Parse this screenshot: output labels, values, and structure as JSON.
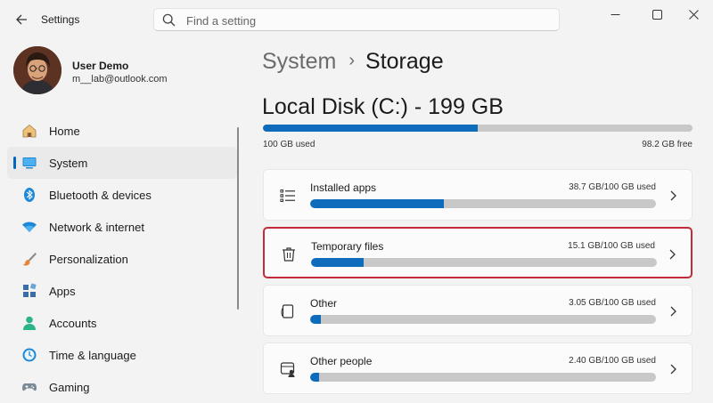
{
  "titlebar": {
    "back": "←",
    "title": "Settings",
    "search_placeholder": "Find a setting"
  },
  "profile": {
    "name": "User Demo",
    "email": "m__lab@outlook.com"
  },
  "sidebar": {
    "items": [
      {
        "label": "Home",
        "icon": "home-icon"
      },
      {
        "label": "System",
        "icon": "system-monitor-icon",
        "active": true
      },
      {
        "label": "Bluetooth & devices",
        "icon": "bluetooth-icon"
      },
      {
        "label": "Network & internet",
        "icon": "wifi-icon"
      },
      {
        "label": "Personalization",
        "icon": "paintbrush-icon"
      },
      {
        "label": "Apps",
        "icon": "apps-icon"
      },
      {
        "label": "Accounts",
        "icon": "person-icon"
      },
      {
        "label": "Time & language",
        "icon": "globe-clock-icon"
      },
      {
        "label": "Gaming",
        "icon": "gamepad-icon"
      }
    ]
  },
  "main": {
    "breadcrumb": {
      "parent": "System",
      "separator": "›",
      "current": "Storage"
    },
    "disk": {
      "title": "Local Disk (C:) - 199 GB",
      "used_label": "100 GB used",
      "free_label": "98.2 GB free",
      "used_fraction": 0.5
    },
    "categories": [
      {
        "name": "Installed apps",
        "size": "38.7 GB/100 GB used",
        "fraction": 0.387,
        "icon": "list-icon",
        "highlight": false
      },
      {
        "name": "Temporary files",
        "size": "15.1 GB/100 GB used",
        "fraction": 0.151,
        "icon": "trash-icon",
        "highlight": true
      },
      {
        "name": "Other",
        "size": "3.05 GB/100 GB used",
        "fraction": 0.0305,
        "icon": "document-icon",
        "highlight": false
      },
      {
        "name": "Other people",
        "size": "2.40 GB/100 GB used",
        "fraction": 0.024,
        "icon": "people-icon",
        "highlight": false
      }
    ]
  },
  "colors": {
    "accent": "#0f6cbd",
    "highlight_border": "#c42b3a",
    "bar_track": "#c8c8c8"
  }
}
